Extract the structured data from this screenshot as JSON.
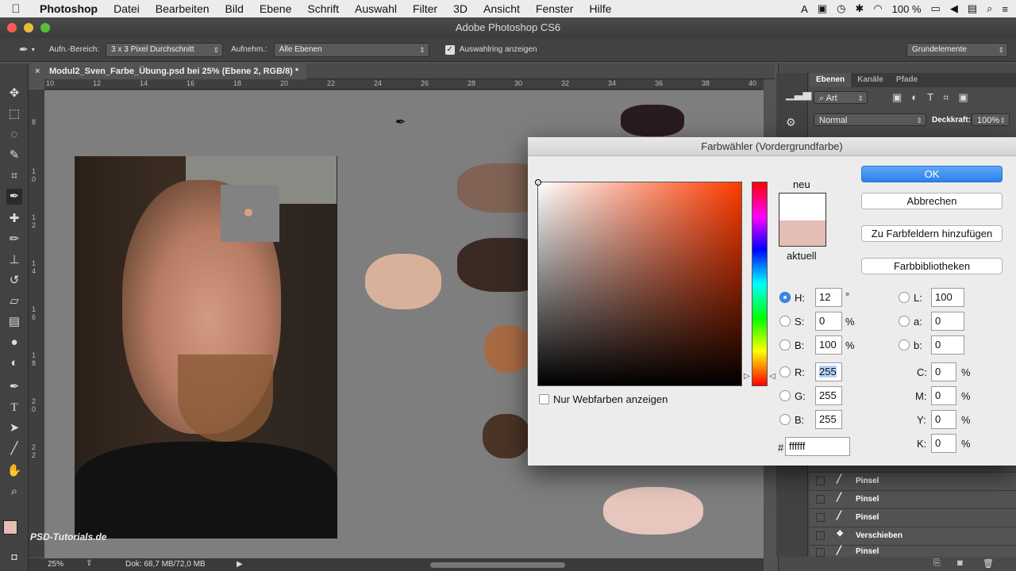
{
  "menubar": {
    "app": "Photoshop",
    "items": [
      "Datei",
      "Bearbeiten",
      "Bild",
      "Ebene",
      "Schrift",
      "Auswahl",
      "Filter",
      "3D",
      "Ansicht",
      "Fenster",
      "Hilfe"
    ],
    "battery": "100 %"
  },
  "window": {
    "title": "Adobe Photoshop CS6"
  },
  "options": {
    "sample_size_label": "Aufn.-Bereich:",
    "sample_size_value": "3 x 3 Pixel Durchschnitt",
    "sample_label": "Aufnehm.:",
    "sample_value": "Alle Ebenen",
    "show_ring_label": "Auswahlring anzeigen",
    "workspace": "Grundelemente"
  },
  "document": {
    "tab_title": "Modul2_Sven_Farbe_Übung.psd bei 25% (Ebene 2, RGB/8) *",
    "ruler_h": [
      "10",
      "12",
      "14",
      "16",
      "18",
      "20",
      "22",
      "24",
      "26",
      "28",
      "30",
      "32",
      "34",
      "36",
      "38",
      "40"
    ],
    "ruler_v": [
      "8",
      "1 0",
      "1 2",
      "1 4",
      "1 6",
      "1 8",
      "2 0",
      "2 2"
    ]
  },
  "status": {
    "zoom": "25%",
    "doc": "Dok: 68,7 MB/72,0 MB"
  },
  "watermark": "PSD-Tutorials.de",
  "panels": {
    "tabs": [
      "Ebenen",
      "Kanäle",
      "Pfade"
    ],
    "filter": "Art",
    "blend_mode": "Normal",
    "opacity_label": "Deckkraft:",
    "opacity_value": "100%",
    "layers": [
      "Pinsel",
      "Pinsel",
      "Pinsel",
      "Verschieben",
      "Pinsel"
    ]
  },
  "dialog": {
    "title": "Farbwähler (Vordergrundfarbe)",
    "new_label": "neu",
    "current_label": "aktuell",
    "ok": "OK",
    "cancel": "Abbrechen",
    "add_swatches": "Zu Farbfeldern hinzufügen",
    "libraries": "Farbbibliotheken",
    "web_only": "Nur Webfarben anzeigen",
    "new_color": "#ffffff",
    "current_color": "#e4bdb5",
    "hsb": {
      "h": "12",
      "s": "0",
      "b": "100",
      "h_unit": "°",
      "s_unit": "%",
      "b_unit": "%"
    },
    "rgb": {
      "r": "255",
      "g": "255",
      "b": "255"
    },
    "lab": {
      "l": "100",
      "a": "0",
      "b": "0"
    },
    "cmyk": {
      "c": "0",
      "m": "0",
      "y": "0",
      "k": "0"
    },
    "hex": "ffffff",
    "labels": {
      "H": "H:",
      "S": "S:",
      "B": "B:",
      "R": "R:",
      "G": "G:",
      "Bb": "B:",
      "L": "L:",
      "a": "a:",
      "lb": "b:",
      "C": "C:",
      "M": "M:",
      "Y": "Y:",
      "K": "K:",
      "hash": "#"
    }
  }
}
